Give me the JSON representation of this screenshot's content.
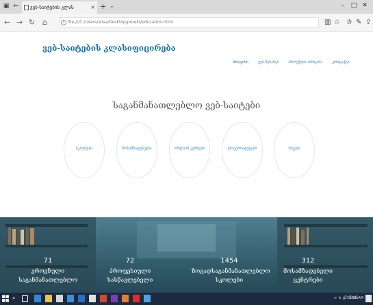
{
  "browser": {
    "tab_title": "ვებ-საიტების კლას",
    "url": "file:///C:/Users/alisa/Desktop/proekt/education.html",
    "new_tab": "+",
    "tab_close": "×",
    "window_controls": [
      "–",
      "□",
      "✕"
    ],
    "nav_icons": [
      "back-arrow-icon",
      "forward-arrow-icon",
      "refresh-icon",
      "home-icon"
    ],
    "toolbar_icons": [
      "reading-view-icon",
      "favorite-star-icon",
      "favorites-list-icon",
      "notes-icon",
      "share-icon",
      "more-icon"
    ]
  },
  "site": {
    "title": "ვებ-საიტების კლასიფიცირება",
    "nav": [
      "მთავარი",
      "ვებ-შესახებ",
      "პროექტის ამოცანა",
      "კონტაქტი"
    ],
    "nav_active_index": 0
  },
  "hero": {
    "title": "საგანმანათლებლო ვებ-საიტები",
    "categories": [
      "სკოლები",
      "მოსამზადებელი",
      "ონლაინ კურსები",
      "უნივერსიტეტები",
      "სხვები"
    ]
  },
  "stats": [
    {
      "number": "71",
      "label_line1": "ეროვნული",
      "label_line2": "საგანმანათლებლო"
    },
    {
      "number": "72",
      "label_line1": "პროფესიული",
      "label_line2": "სასწავლებელი"
    },
    {
      "number": "1454",
      "label_line1": "ზოგადსაგანმანათლებლო",
      "label_line2": "სკოლები"
    },
    {
      "number": "312",
      "label_line1": "მოსამზადებელი",
      "label_line2": "ცენტრები"
    }
  ],
  "taskbar": {
    "tray_text": "ᨀ ∧ 🔊 ENG",
    "clock": "10:21 AM"
  },
  "colors": {
    "title_blue": "#0f6fa8",
    "link_blue": "#2d8ccc",
    "banner_teal": "#3e6b7c",
    "taskbar": "#1b2a40"
  }
}
